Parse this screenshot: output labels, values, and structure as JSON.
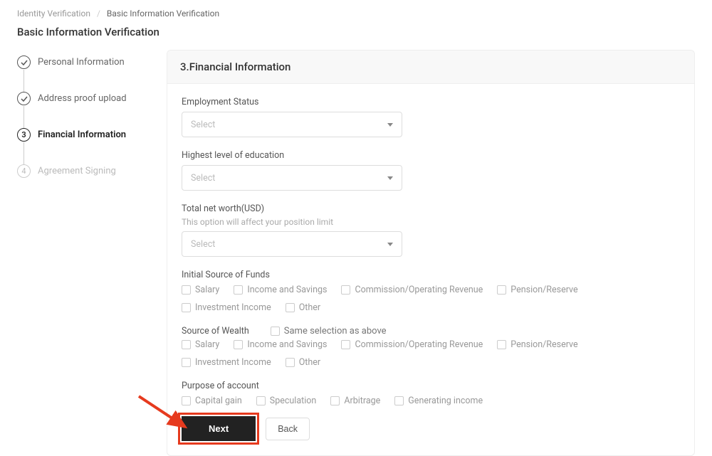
{
  "breadcrumb": {
    "root": "Identity Verification",
    "current": "Basic Information Verification"
  },
  "page_title": "Basic Information Verification",
  "steps": [
    {
      "label": "Personal Information",
      "state": "done"
    },
    {
      "label": "Address proof upload",
      "state": "done"
    },
    {
      "label": "Financial Information",
      "state": "current",
      "num": "3"
    },
    {
      "label": "Agreement Signing",
      "state": "future",
      "num": "4"
    }
  ],
  "panel": {
    "title": "3.Financial Information",
    "employment": {
      "label": "Employment Status",
      "placeholder": "Select"
    },
    "education": {
      "label": "Highest level of education",
      "placeholder": "Select"
    },
    "networth": {
      "label": "Total net worth(USD)",
      "hint": "This option will affect your position limit",
      "placeholder": "Select"
    },
    "funds": {
      "label": "Initial Source of Funds",
      "options": [
        "Salary",
        "Income and Savings",
        "Commission/Operating Revenue",
        "Pension/Reserve",
        "Investment Income",
        "Other"
      ]
    },
    "wealth": {
      "label": "Source of Wealth",
      "same_label": "Same selection as above",
      "options": [
        "Salary",
        "Income and Savings",
        "Commission/Operating Revenue",
        "Pension/Reserve",
        "Investment Income",
        "Other"
      ]
    },
    "purpose": {
      "label": "Purpose of account",
      "options": [
        "Capital gain",
        "Speculation",
        "Arbitrage",
        "Generating income"
      ]
    },
    "next_label": "Next",
    "back_label": "Back"
  }
}
